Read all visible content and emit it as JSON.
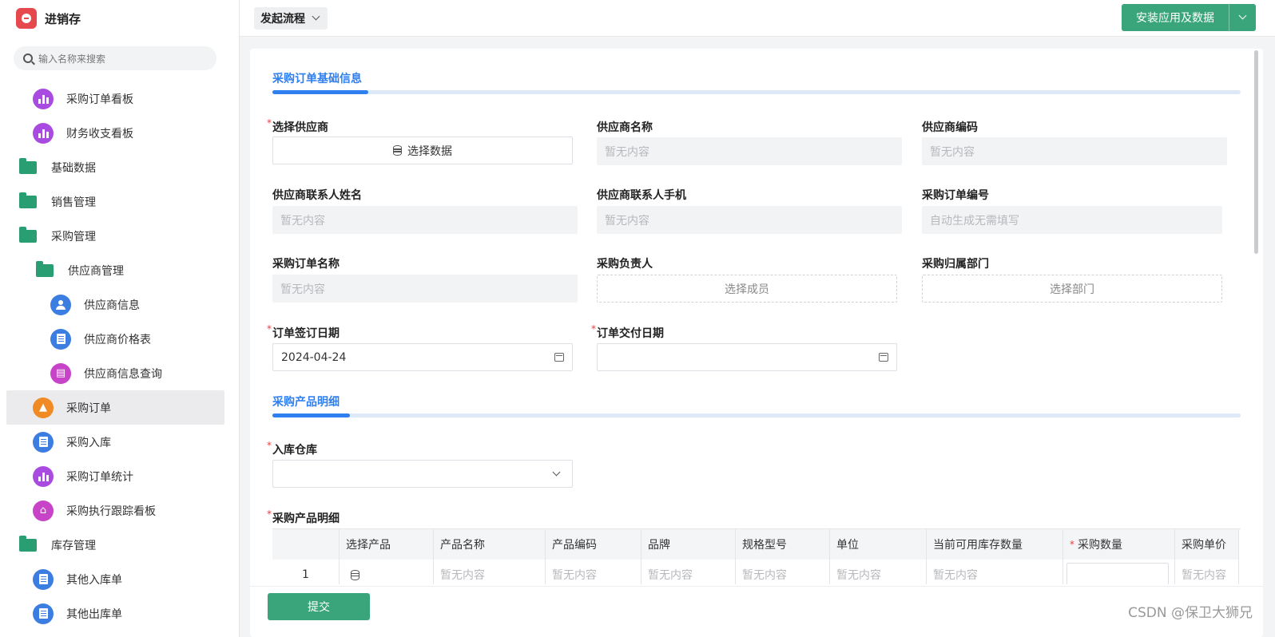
{
  "app": {
    "title": "进销存"
  },
  "search": {
    "placeholder": "输入名称来搜索"
  },
  "sidebar": {
    "items": [
      {
        "label": "采购订单看板"
      },
      {
        "label": "财务收支看板"
      },
      {
        "label": "基础数据"
      },
      {
        "label": "销售管理"
      },
      {
        "label": "采购管理"
      },
      {
        "label": "供应商管理"
      },
      {
        "label": "供应商信息"
      },
      {
        "label": "供应商价格表"
      },
      {
        "label": "供应商信息查询"
      },
      {
        "label": "采购订单"
      },
      {
        "label": "采购入库"
      },
      {
        "label": "采购订单统计"
      },
      {
        "label": "采购执行跟踪看板"
      },
      {
        "label": "库存管理"
      },
      {
        "label": "其他入库单"
      },
      {
        "label": "其他出库单"
      }
    ]
  },
  "toolbar": {
    "flow_label": "发起流程",
    "install_label": "安装应用及数据"
  },
  "form": {
    "section1_title": "采购订单基础信息",
    "section2_title": "采购产品明细",
    "supplier_label": "选择供应商",
    "supplier_button": "选择数据",
    "supplier_name_label": "供应商名称",
    "supplier_code_label": "供应商编码",
    "contact_name_label": "供应商联系人姓名",
    "contact_phone_label": "供应商联系人手机",
    "order_no_label": "采购订单编号",
    "order_name_label": "采购订单名称",
    "owner_label": "采购负责人",
    "dept_label": "采购归属部门",
    "sign_date_label": "订单签订日期",
    "delivery_date_label": "订单交付日期",
    "warehouse_label": "入库仓库",
    "detail_label": "采购产品明细",
    "empty": "暂无内容",
    "auto_gen": "自动生成无需填写",
    "choose_member": "选择成员",
    "choose_dept": "选择部门",
    "sign_date_value": "2024-04-24",
    "submit_label": "提交"
  },
  "table": {
    "headers": [
      "",
      "选择产品",
      "产品名称",
      "产品编码",
      "品牌",
      "规格型号",
      "单位",
      "当前可用库存数量",
      "采购数量",
      "采购单价"
    ],
    "row": {
      "index": "1",
      "empty": "暂无内容"
    }
  },
  "watermark": "CSDN @保卫大狮兄",
  "colors": {
    "accent": "#2f7ff0",
    "primary_green": "#3aa57b",
    "required": "#e94040"
  }
}
